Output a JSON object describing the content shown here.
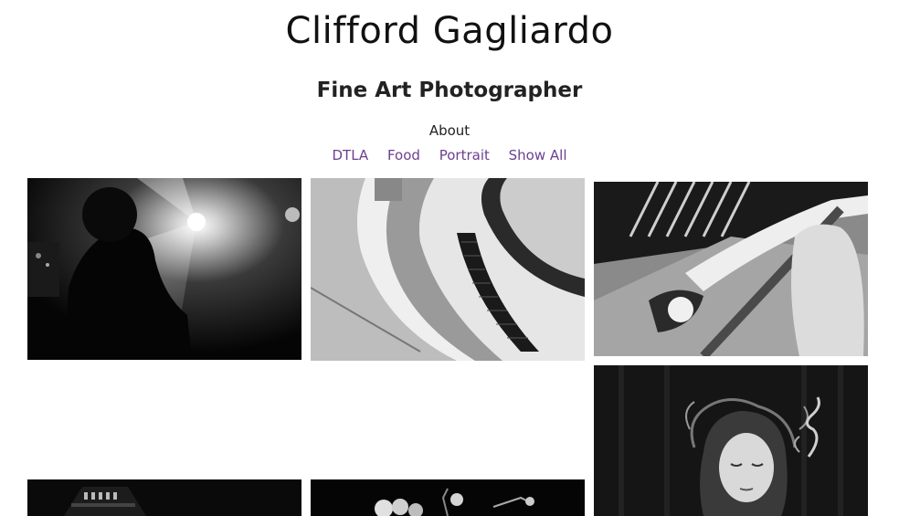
{
  "site": {
    "title": "Clifford Gagliardo",
    "subtitle": "Fine Art Photographer"
  },
  "nav": {
    "primary": [
      {
        "label": "About"
      }
    ],
    "galleries": [
      {
        "label": "DTLA"
      },
      {
        "label": "Food"
      },
      {
        "label": "Portrait"
      },
      {
        "label": "Show All"
      }
    ]
  },
  "colors": {
    "link": "#6b3f8f",
    "text": "#111111",
    "background": "#ffffff"
  },
  "gallery": {
    "photos": [
      {
        "name": "concert-light-silhouette"
      },
      {
        "name": "spiral-staircase"
      },
      {
        "name": "handrail-figure"
      },
      {
        "name": "woman-smoke-portrait"
      },
      {
        "name": "dark-building"
      },
      {
        "name": "flowers-still-life"
      }
    ]
  }
}
